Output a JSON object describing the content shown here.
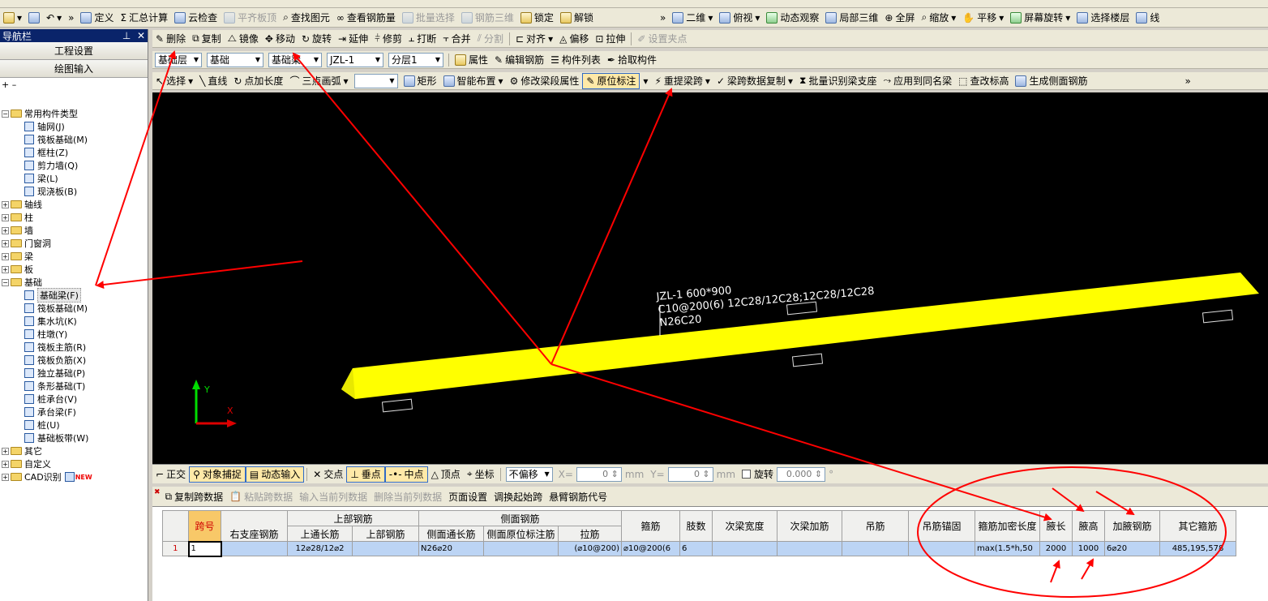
{
  "toolbar1": {
    "define": "定义",
    "summary": "汇总计算",
    "cloud_check": "云检查",
    "flat_slab_top": "平齐板顶",
    "find_element": "查找图元",
    "view_rebar": "查看钢筋量",
    "batch_select": "批量选择",
    "rebar_3d": "钢筋三维",
    "lock": "锁定",
    "unlock": "解锁",
    "view_2d": "二维",
    "top_view": "俯视",
    "dynamic_view": "动态观察",
    "local_3d": "局部三维",
    "full_screen": "全屏",
    "zoom": "缩放",
    "pan": "平移",
    "screen_rotate": "屏幕旋转",
    "select_floor": "选择楼层",
    "line_frame": "线"
  },
  "nav": {
    "title": "导航栏",
    "project_settings": "工程设置",
    "drawing_input": "绘图输入",
    "tree": [
      {
        "label": "常用构件类型",
        "type": "folder",
        "expanded": true
      },
      {
        "label": "轴网(J)",
        "type": "leaf"
      },
      {
        "label": "筏板基础(M)",
        "type": "leaf"
      },
      {
        "label": "框柱(Z)",
        "type": "leaf"
      },
      {
        "label": "剪力墙(Q)",
        "type": "leaf"
      },
      {
        "label": "梁(L)",
        "type": "leaf"
      },
      {
        "label": "现浇板(B)",
        "type": "leaf"
      },
      {
        "label": "轴线",
        "type": "folder"
      },
      {
        "label": "柱",
        "type": "folder"
      },
      {
        "label": "墙",
        "type": "folder"
      },
      {
        "label": "门窗洞",
        "type": "folder"
      },
      {
        "label": "梁",
        "type": "folder"
      },
      {
        "label": "板",
        "type": "folder"
      },
      {
        "label": "基础",
        "type": "folder",
        "expanded": true
      },
      {
        "label": "基础梁(F)",
        "type": "leaf",
        "selected": true
      },
      {
        "label": "筏板基础(M)",
        "type": "leaf"
      },
      {
        "label": "集水坑(K)",
        "type": "leaf"
      },
      {
        "label": "柱墩(Y)",
        "type": "leaf"
      },
      {
        "label": "筏板主筋(R)",
        "type": "leaf"
      },
      {
        "label": "筏板负筋(X)",
        "type": "leaf"
      },
      {
        "label": "独立基础(P)",
        "type": "leaf"
      },
      {
        "label": "条形基础(T)",
        "type": "leaf"
      },
      {
        "label": "桩承台(V)",
        "type": "leaf"
      },
      {
        "label": "承台梁(F)",
        "type": "leaf"
      },
      {
        "label": "桩(U)",
        "type": "leaf"
      },
      {
        "label": "基础板带(W)",
        "type": "leaf"
      },
      {
        "label": "其它",
        "type": "folder"
      },
      {
        "label": "自定义",
        "type": "folder"
      },
      {
        "label": "CAD识别",
        "type": "folder",
        "badge": "NEW"
      }
    ]
  },
  "toolbar2": {
    "delete": "删除",
    "copy": "复制",
    "mirror": "镜像",
    "move": "移动",
    "rotate": "旋转",
    "extend": "延伸",
    "trim": "修剪",
    "break": "打断",
    "merge": "合并",
    "split": "分割",
    "align": "对齐",
    "offset": "偏移",
    "stretch": "拉伸",
    "set_grip": "设置夹点"
  },
  "toolbar3": {
    "floor": "基础层",
    "category": "基础",
    "component_type": "基础梁",
    "component": "JZL-1",
    "layer": "分层1",
    "property": "属性",
    "edit_rebar": "编辑钢筋",
    "component_list": "构件列表",
    "pick_component": "拾取构件"
  },
  "toolbar4": {
    "select": "选择",
    "line": "直线",
    "point_length": "点加长度",
    "three_point_arc": "三点画弧",
    "rect": "矩形",
    "smart_layout": "智能布置",
    "modify_segment": "修改梁段属性",
    "inplace_label": "原位标注",
    "reextract_span": "重提梁跨",
    "copy_span_data": "梁跨数据复制",
    "batch_support": "批量识别梁支座",
    "apply_same": "应用到同名梁",
    "check_elev": "查改标高",
    "side_rebar": "生成侧面钢筋"
  },
  "canvas": {
    "beam_label_line1": "JZL-1 600*900",
    "beam_label_line2": "C10@200(6) 12C28/12C28;12C28/12C28",
    "beam_label_line3": "N26C20",
    "axis_y": "Y",
    "axis_x": "X",
    "beam_color": "#ffff00",
    "arrow_color": "#ff0000"
  },
  "snapbar": {
    "ortho": "正交",
    "object_snap": "对象捕捉",
    "dynamic_input": "动态输入",
    "intersection": "交点",
    "perpendicular": "垂点",
    "midpoint": "中点",
    "vertex": "顶点",
    "coordinate": "坐标",
    "offset_mode": "不偏移",
    "x_label": "X=",
    "x_value": "0",
    "y_label": "Y=",
    "y_value": "0",
    "unit": "mm",
    "rotate": "旋转",
    "rotate_value": "0.000",
    "degree": "°"
  },
  "gridtb": {
    "copy_span": "复制跨数据",
    "paste_span": "粘贴跨数据",
    "input_col": "输入当前列数据",
    "delete_col": "删除当前列数据",
    "page_setup": "页面设置",
    "swap_start": "调换起始跨",
    "cantilever_code": "悬臂钢筋代号"
  },
  "grid": {
    "headers": {
      "span_no": "跨号",
      "right_support": "右支座钢筋",
      "top_rebar": "上部钢筋",
      "top_through": "上通长筋",
      "top_part": "上部钢筋",
      "side_rebar": "侧面钢筋",
      "side_through": "侧面通长筋",
      "side_inplace": "侧面原位标注筋",
      "tie": "拉筋",
      "stirrup": "箍筋",
      "legs": "肢数",
      "sub_beam_width": "次梁宽度",
      "sub_beam_add": "次梁加筋",
      "hanger": "吊筋",
      "hanger_anchor": "吊筋锚固",
      "stirrup_dense_len": "箍筋加密长度",
      "haunch_len": "腋长",
      "haunch_height": "腋高",
      "haunch_rebar": "加腋钢筋",
      "other_stirrup": "其它箍筋"
    },
    "row": {
      "index": "1",
      "span_no": "1",
      "right_support": "",
      "top_through": "12⌀28/12⌀2",
      "top_part": "",
      "side_through": "N26⌀20",
      "side_inplace": "",
      "tie": "(⌀10@200)",
      "stirrup": "⌀10@200(6",
      "legs": "6",
      "sub_beam_width": "",
      "sub_beam_add": "",
      "hanger": "",
      "hanger_anchor": "",
      "stirrup_dense_len": "max(1.5*h,50",
      "haunch_len": "2000",
      "haunch_height": "1000",
      "haunch_rebar": "6⌀20",
      "other_stirrup": "485,195,578"
    }
  }
}
